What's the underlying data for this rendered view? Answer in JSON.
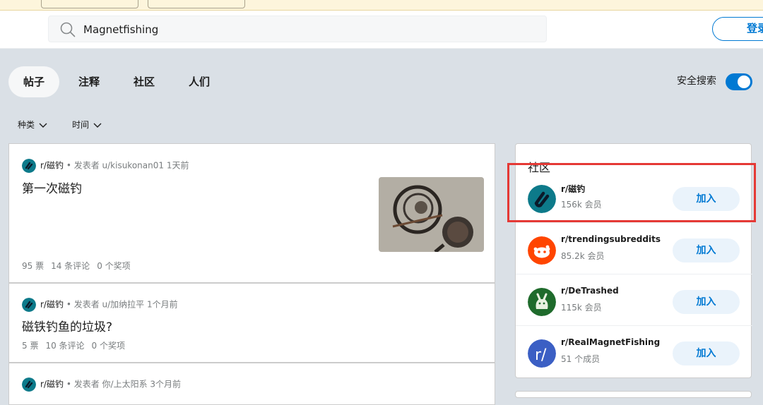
{
  "search": {
    "value": "Magnetfishing"
  },
  "header": {
    "login_label": "登录"
  },
  "tabs": [
    {
      "label": "帖子",
      "active": true
    },
    {
      "label": "注释",
      "active": false
    },
    {
      "label": "社区",
      "active": false
    },
    {
      "label": "人们",
      "active": false
    }
  ],
  "safe_search": {
    "label": "安全搜索",
    "enabled": true
  },
  "filters": {
    "type_label": "种类",
    "time_label": "时间"
  },
  "posts": [
    {
      "subreddit": "r/磁钓",
      "byline": "• 发表者 u/kisukonan01 1天前",
      "title_plain": "第一次",
      "title_hl": "磁钓",
      "votes": "95 票",
      "comments": "14 条评论",
      "awards": "0 个奖项"
    },
    {
      "subreddit": "r/磁钓",
      "byline": "• 发表者 u/加纳拉平 1个月前",
      "title_hl": "磁铁钓鱼",
      "title_plain": "的垃圾?",
      "votes": "5 票",
      "comments": "10 条评论",
      "awards": "0 个奖项"
    },
    {
      "subreddit": "r/磁钓",
      "byline": "• 发表者 你/上太阳系 3个月前"
    }
  ],
  "sidebar": {
    "heading": "社区",
    "communities": [
      {
        "name": "r/磁钓",
        "members": "156k 会员",
        "join": "加入",
        "icon": "magnet-icon",
        "color": "#0d7a8a"
      },
      {
        "name": "r/trendingsubreddits",
        "members": "85.2k 会员",
        "join": "加入",
        "icon": "reddit-alien-icon",
        "color": "#ff4500"
      },
      {
        "name": "r/DeTrashed",
        "members": "115k 会员",
        "join": "加入",
        "icon": "trash-bag-icon",
        "color": "#1f6b2c"
      },
      {
        "name": "r/RealMagnetFishing",
        "members": "51 个成员",
        "join": "加入",
        "icon": "subreddit-r-icon",
        "color": "#3b5fc4"
      }
    ]
  }
}
